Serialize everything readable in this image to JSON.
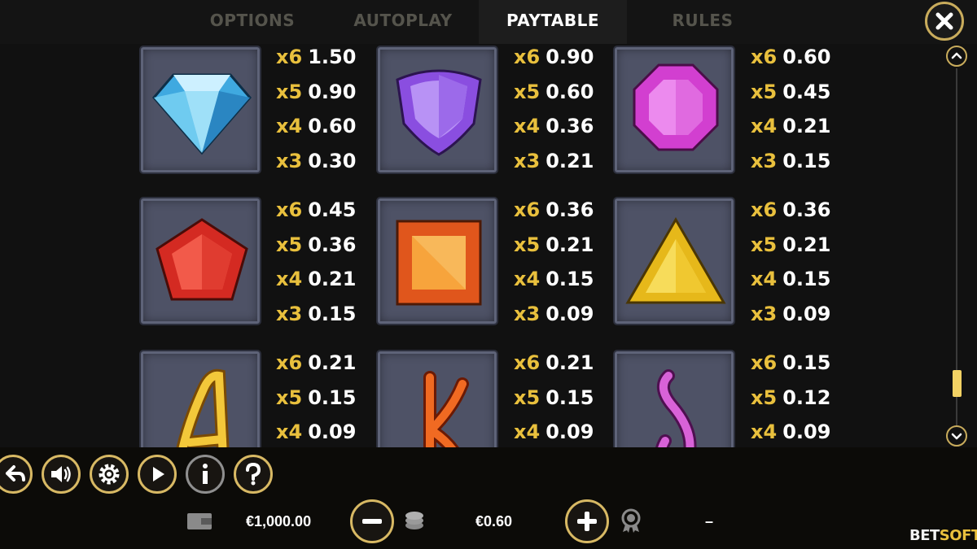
{
  "tabs": [
    {
      "label": "OPTIONS",
      "active": false
    },
    {
      "label": "AUTOPLAY",
      "active": false
    },
    {
      "label": "PAYTABLE",
      "active": true
    },
    {
      "label": "RULES",
      "active": false
    }
  ],
  "paytable": [
    {
      "symbol": "blue-diamond",
      "pays": [
        [
          "x6",
          "1.50"
        ],
        [
          "x5",
          "0.90"
        ],
        [
          "x4",
          "0.60"
        ],
        [
          "x3",
          "0.30"
        ]
      ]
    },
    {
      "symbol": "purple-shield-gem",
      "pays": [
        [
          "x6",
          "0.90"
        ],
        [
          "x5",
          "0.60"
        ],
        [
          "x4",
          "0.36"
        ],
        [
          "x3",
          "0.21"
        ]
      ]
    },
    {
      "symbol": "pink-octagon-gem",
      "pays": [
        [
          "x6",
          "0.60"
        ],
        [
          "x5",
          "0.45"
        ],
        [
          "x4",
          "0.21"
        ],
        [
          "x3",
          "0.15"
        ]
      ]
    },
    {
      "symbol": "red-pentagon-gem",
      "pays": [
        [
          "x6",
          "0.45"
        ],
        [
          "x5",
          "0.36"
        ],
        [
          "x4",
          "0.21"
        ],
        [
          "x3",
          "0.15"
        ]
      ]
    },
    {
      "symbol": "orange-square-gem",
      "pays": [
        [
          "x6",
          "0.36"
        ],
        [
          "x5",
          "0.21"
        ],
        [
          "x4",
          "0.15"
        ],
        [
          "x3",
          "0.09"
        ]
      ]
    },
    {
      "symbol": "yellow-triangle-gem",
      "pays": [
        [
          "x6",
          "0.36"
        ],
        [
          "x5",
          "0.21"
        ],
        [
          "x4",
          "0.15"
        ],
        [
          "x3",
          "0.09"
        ]
      ]
    },
    {
      "symbol": "letter-a",
      "pays": [
        [
          "x6",
          "0.21"
        ],
        [
          "x5",
          "0.15"
        ],
        [
          "x4",
          "0.09"
        ]
      ]
    },
    {
      "symbol": "letter-k",
      "pays": [
        [
          "x6",
          "0.21"
        ],
        [
          "x5",
          "0.15"
        ],
        [
          "x4",
          "0.09"
        ]
      ]
    },
    {
      "symbol": "letter-q",
      "pays": [
        [
          "x6",
          "0.15"
        ],
        [
          "x5",
          "0.12"
        ],
        [
          "x4",
          "0.09"
        ]
      ]
    }
  ],
  "bottom": {
    "balance": "€1,000.00",
    "bet": "€0.60",
    "win": "–",
    "logo_bet": "BET",
    "logo_soft": "SOFT"
  },
  "icons": {
    "close": "close-icon",
    "scroll_up": "chevron-up-icon",
    "scroll_down": "chevron-down-icon",
    "back": "back-arrow-icon",
    "sound": "speaker-icon",
    "settings": "gear-icon",
    "autoplay": "autoplay-icon",
    "info": "info-icon",
    "help": "help-icon",
    "wallet": "wallet-icon",
    "coins": "coins-icon",
    "win": "award-icon",
    "minus": "minus-icon",
    "plus": "plus-icon"
  },
  "colors": {
    "accent_gold": "#d8b964",
    "multiplier": "#e9c03d",
    "tab_inactive": "#55544c"
  }
}
